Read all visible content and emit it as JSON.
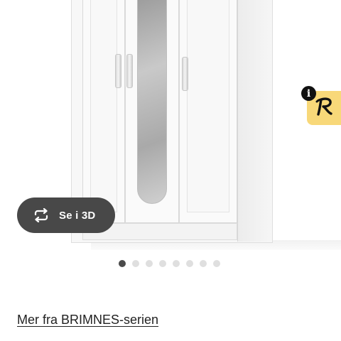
{
  "product_gallery": {
    "view_3d_label": "Se i 3D",
    "view_3d_icon": "rotate-3d-icon",
    "info_icon": "info-icon",
    "info_glyph": "i",
    "badge_icon": "brand-r-icon",
    "slide_count": 8,
    "active_slide": 1
  },
  "series_link": {
    "label": "Mer fra BRIMNES-serien"
  },
  "colors": {
    "pill_background": "#484848",
    "badge_yellow": "#f8d879",
    "dot_active": "#4a4a4a",
    "dot_inactive": "#dfdfdf"
  }
}
